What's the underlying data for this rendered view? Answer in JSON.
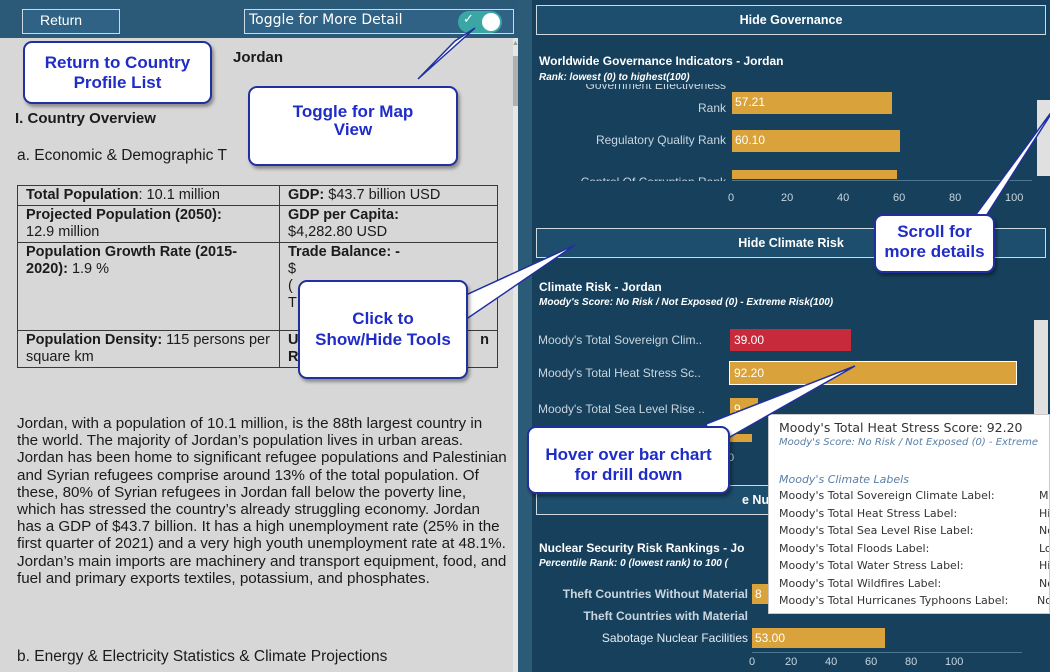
{
  "toolbar": {
    "return_label": "Return",
    "toggle_label": "Toggle for More Detail",
    "toggle_check": "✓"
  },
  "profile": {
    "country": "Jordan",
    "section_i": "I.  Country Overview",
    "subsection_a": "a.  Economic & Demographic T",
    "table": [
      [
        {
          "label": "Total Population",
          "value": ": 10.1 million"
        },
        {
          "label": "GDP:",
          "value": " $43.7 billion USD"
        }
      ],
      [
        {
          "label": "Projected Population (2050):",
          "value": "12.9 million"
        },
        {
          "label": "GDP per Capita:",
          "value": "$4,282.80 USD"
        }
      ],
      [
        {
          "label": "Population Growth Rate (2015-2020):",
          "value": " 1.9 %"
        },
        {
          "label": "Trade Balance: -",
          "value": "$\n(\nT"
        }
      ],
      [
        {
          "label": "Population Density:",
          "value": " 115 persons per square km"
        },
        {
          "label": "U",
          "value": "R"
        }
      ]
    ],
    "table_partial_right": "n",
    "paragraph": "Jordan, with a population of 10.1 million, is the 88th largest country in the world. The majority of Jordan’s population lives in urban areas. Jordan has been home to significant refugee populations and Palestinian and Syrian refugees comprise around 13% of the total population. Of these, 80% of Syrian refugees in Jordan fall below the poverty line, which has stressed the country’s already struggling economy. Jordan has a GDP of $43.7 billion. It has a high unemployment rate (25% in the first quarter of 2021) and a very high youth unemployment rate at 48.1%. Jordan’s main imports are machinery and transport equipment, food, and fuel and primary exports textiles, potassium, and phosphates.",
    "subsection_b": "b.  Energy & Electricity Statistics & Climate Projections"
  },
  "governance": {
    "hide_label": "Hide Governance",
    "title": "Worldwide Governance Indicators - Jordan",
    "subtitle": "Rank: lowest (0) to highest(100)",
    "partial_top_label": "Government Effectiveness",
    "rank_suffix": "Rank",
    "bars": [
      {
        "label": "Regulatory Quality Rank",
        "value": 60.1,
        "display": "60.10"
      },
      {
        "label": "Control Of Corruption Rank",
        "value": 59.0,
        "display": "59.00"
      }
    ],
    "top_bar": {
      "value": 57.21,
      "display": "57.21"
    },
    "ticks": [
      "0",
      "20",
      "40",
      "60",
      "80",
      "100"
    ]
  },
  "climate": {
    "hide_label": "Hide Climate Risk",
    "title": "Climate Risk - Jordan",
    "subtitle": "Moody's Score: No Risk / Not Exposed (0) - Extreme Risk(100)",
    "bars": [
      {
        "label": "Moody's Total Sovereign Clim..",
        "value": 39.0,
        "display": "39.00",
        "color": "#c72a3a"
      },
      {
        "label": "Moody's Total Heat Stress Sc..",
        "value": 92.2,
        "display": "92.20",
        "color": "#d9a23a"
      },
      {
        "label": "Moody's Total Sea Level Rise ..",
        "value": 9.0,
        "display": "9",
        "color": "#d9a23a"
      }
    ],
    "tick0": "0"
  },
  "nuclear": {
    "hide_label_partial": "e Nuc",
    "title": "Nuclear Security Risk Rankings - Jo",
    "subtitle": "Percentile Rank: 0 (lowest rank) to 100 (",
    "bars": [
      {
        "label": "Theft Countries Without Material",
        "value": 8.0,
        "display": "8"
      },
      {
        "label": "Theft Countries with Material",
        "value": 0,
        "display": ""
      },
      {
        "label": "Sabotage Nuclear Facilities",
        "value": 53.0,
        "display": "53.00"
      }
    ],
    "ticks": [
      "0",
      "20",
      "40",
      "60",
      "80",
      "100"
    ]
  },
  "tooltip": {
    "title": "Moody's Total Heat Stress Score: 92.20",
    "subtitle": "Moody's Score: No Risk / Not Exposed (0) - Extreme",
    "heading": "Moody's Climate Labels",
    "rows": [
      {
        "label": "Moody's Total Sovereign Climate Label:",
        "value": "M"
      },
      {
        "label": "Moody's Total Heat Stress Label:",
        "value": "Hi"
      },
      {
        "label": "Moody's Total Sea Level Rise Label:",
        "value": "No"
      },
      {
        "label": "Moody's Total Floods Label:",
        "value": "Lo"
      },
      {
        "label": "Moody's Total Water Stress Label:",
        "value": "Hi"
      },
      {
        "label": "Moody's Total Wildfires Label:",
        "value": "No"
      },
      {
        "label": "Moody's Total Hurricanes Typhoons Label:",
        "value": "No"
      }
    ]
  },
  "callouts": {
    "return": "Return to Country Profile List",
    "map": "Toggle for Map View",
    "tools": "Click to Show/Hide Tools",
    "scroll": "Scroll for more details",
    "hover": "Hover over bar chart for drill down"
  }
}
